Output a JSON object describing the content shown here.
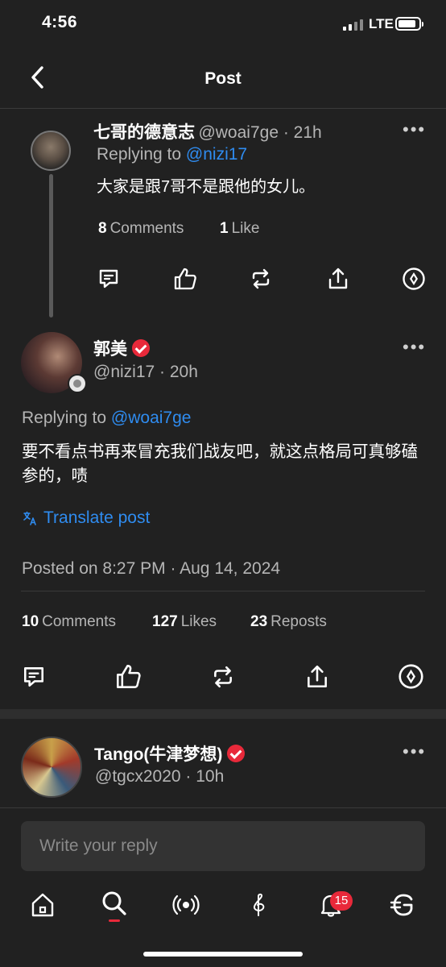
{
  "status_bar": {
    "time": "4:56",
    "network": "LTE"
  },
  "header": {
    "title": "Post"
  },
  "parent_post": {
    "author_name": "七哥的德意志",
    "handle_time": "@woai7ge · 21h",
    "replying_prefix": "Replying to",
    "replying_handle": "@nizi17",
    "text": "大家是跟7哥不是跟他的女儿。",
    "comments_count": "8",
    "comments_label": "Comments",
    "likes_count": "1",
    "likes_label": "Like"
  },
  "main_post": {
    "author_name": "郭美",
    "handle_time": "@nizi17 · 20h",
    "replying_prefix": "Replying to",
    "replying_handle": "@woai7ge",
    "text": "要不看点书再来冒充我们战友吧，就这点格局可真够磕参的，啧",
    "translate_label": "Translate post",
    "posted_on": "Posted on 8:27 PM · Aug 14, 2024",
    "comments_count": "10",
    "comments_label": "Comments",
    "likes_count": "127",
    "likes_label": "Likes",
    "reposts_count": "23",
    "reposts_label": "Reposts"
  },
  "reply_post": {
    "author_name": "Tango(牛津梦想)",
    "handle_time": "@tgcx2020 · 10h"
  },
  "reply_input": {
    "placeholder": "Write your reply"
  },
  "bottom_nav": {
    "items": [
      "home-icon",
      "search-icon",
      "live-broadcast-icon",
      "music-note-icon",
      "bell-icon",
      "currency-g-icon"
    ],
    "notifications_badge": "15"
  },
  "colors": {
    "accent_link": "#2f8cf0",
    "badge_red": "#e8293a",
    "background": "#212121"
  }
}
